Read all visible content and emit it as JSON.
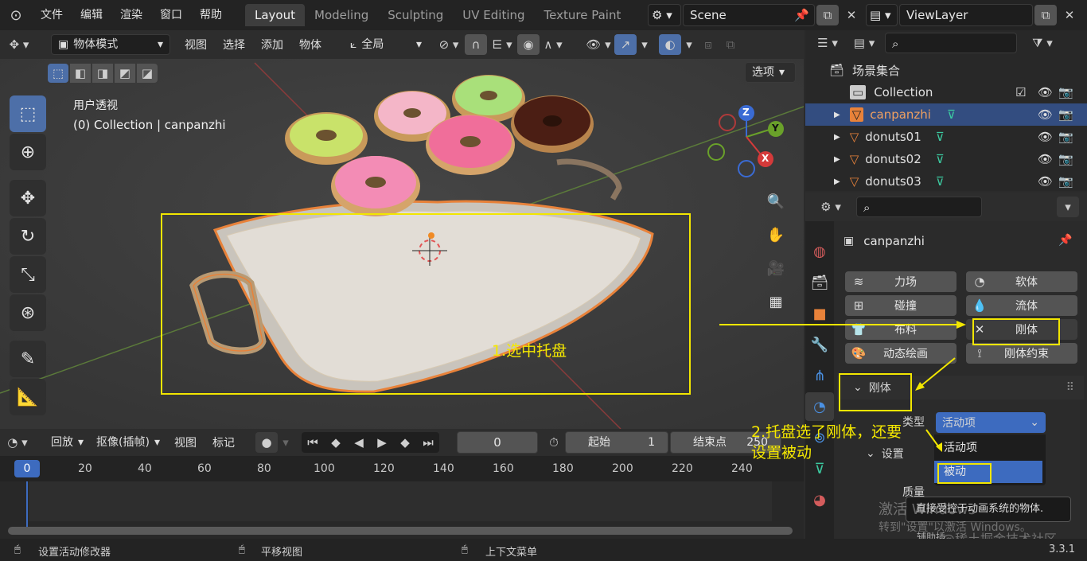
{
  "menu": {
    "items": [
      "文件",
      "编辑",
      "渲染",
      "窗口",
      "帮助"
    ]
  },
  "workspaces": [
    {
      "label": "Layout",
      "active": true
    },
    {
      "label": "Modeling"
    },
    {
      "label": "Sculpting"
    },
    {
      "label": "UV Editing"
    },
    {
      "label": "Texture Paint"
    }
  ],
  "scene": {
    "name": "Scene"
  },
  "view_layer": {
    "name": "ViewLayer"
  },
  "viewport_header": {
    "mode": "物体模式",
    "menus": [
      "视图",
      "选择",
      "添加",
      "物体"
    ],
    "transform": "全局",
    "options": "选项"
  },
  "viewport": {
    "view_name": "用户透视",
    "collection_info": "(0) Collection | canpanzhi",
    "axes": {
      "x": "X",
      "y": "Y",
      "z": "Z"
    },
    "annotation_1": "1.选中托盘"
  },
  "timeline": {
    "playback": "回放",
    "keying": "抠像(插帧)",
    "view": "视图",
    "marker": "标记",
    "current_frame": "0",
    "start_label": "起始",
    "start": "1",
    "end_label": "结束点",
    "end": "250",
    "ruler": [
      "0",
      "20",
      "40",
      "60",
      "80",
      "100",
      "120",
      "140",
      "160",
      "180",
      "200",
      "220",
      "240"
    ]
  },
  "status": {
    "left": "设置活动修改器",
    "mid": "平移视图",
    "right": "上下文菜单",
    "version": "3.3.1"
  },
  "outliner": {
    "root": "场景集合",
    "items": [
      {
        "name": "Collection"
      },
      {
        "name": "canpanzhi",
        "selected": true
      },
      {
        "name": "donuts01"
      },
      {
        "name": "donuts02"
      },
      {
        "name": "donuts03"
      }
    ]
  },
  "properties": {
    "object_name": "canpanzhi",
    "physics_buttons": [
      {
        "label": "力场",
        "icon": "≋"
      },
      {
        "label": "软体",
        "icon": "◔"
      },
      {
        "label": "碰撞",
        "icon": "⊞"
      },
      {
        "label": "流体",
        "icon": "💧"
      },
      {
        "label": "布料",
        "icon": "👕"
      },
      {
        "label": "刚体",
        "icon": "✕"
      },
      {
        "label": "动态绘画",
        "icon": "🎨"
      },
      {
        "label": "刚体约束",
        "icon": "⟟"
      }
    ],
    "rigid_body_panel": "刚体",
    "type_label": "类型",
    "type_value": "活动项",
    "settings_label": "设置",
    "mass_label": "质量",
    "dropdown": {
      "options": [
        "活动项",
        "被动"
      ],
      "selected": "被动"
    },
    "tooltip": "直接受控于动画系统的物体.",
    "annotation_2_line1": "2.托盘选了刚体，还要",
    "annotation_2_line2": "设置被动",
    "partial_label": "辅助插"
  },
  "watermark": {
    "line1": "激活 Windows",
    "line2": "转到\"设置\"以激活 Windows。",
    "community": "@稀土掘金技术社区"
  },
  "colors": {
    "accent": "#4d6fa8",
    "annotation": "#f2e600",
    "selection": "#334d80",
    "object_orange": "#e8823a"
  }
}
